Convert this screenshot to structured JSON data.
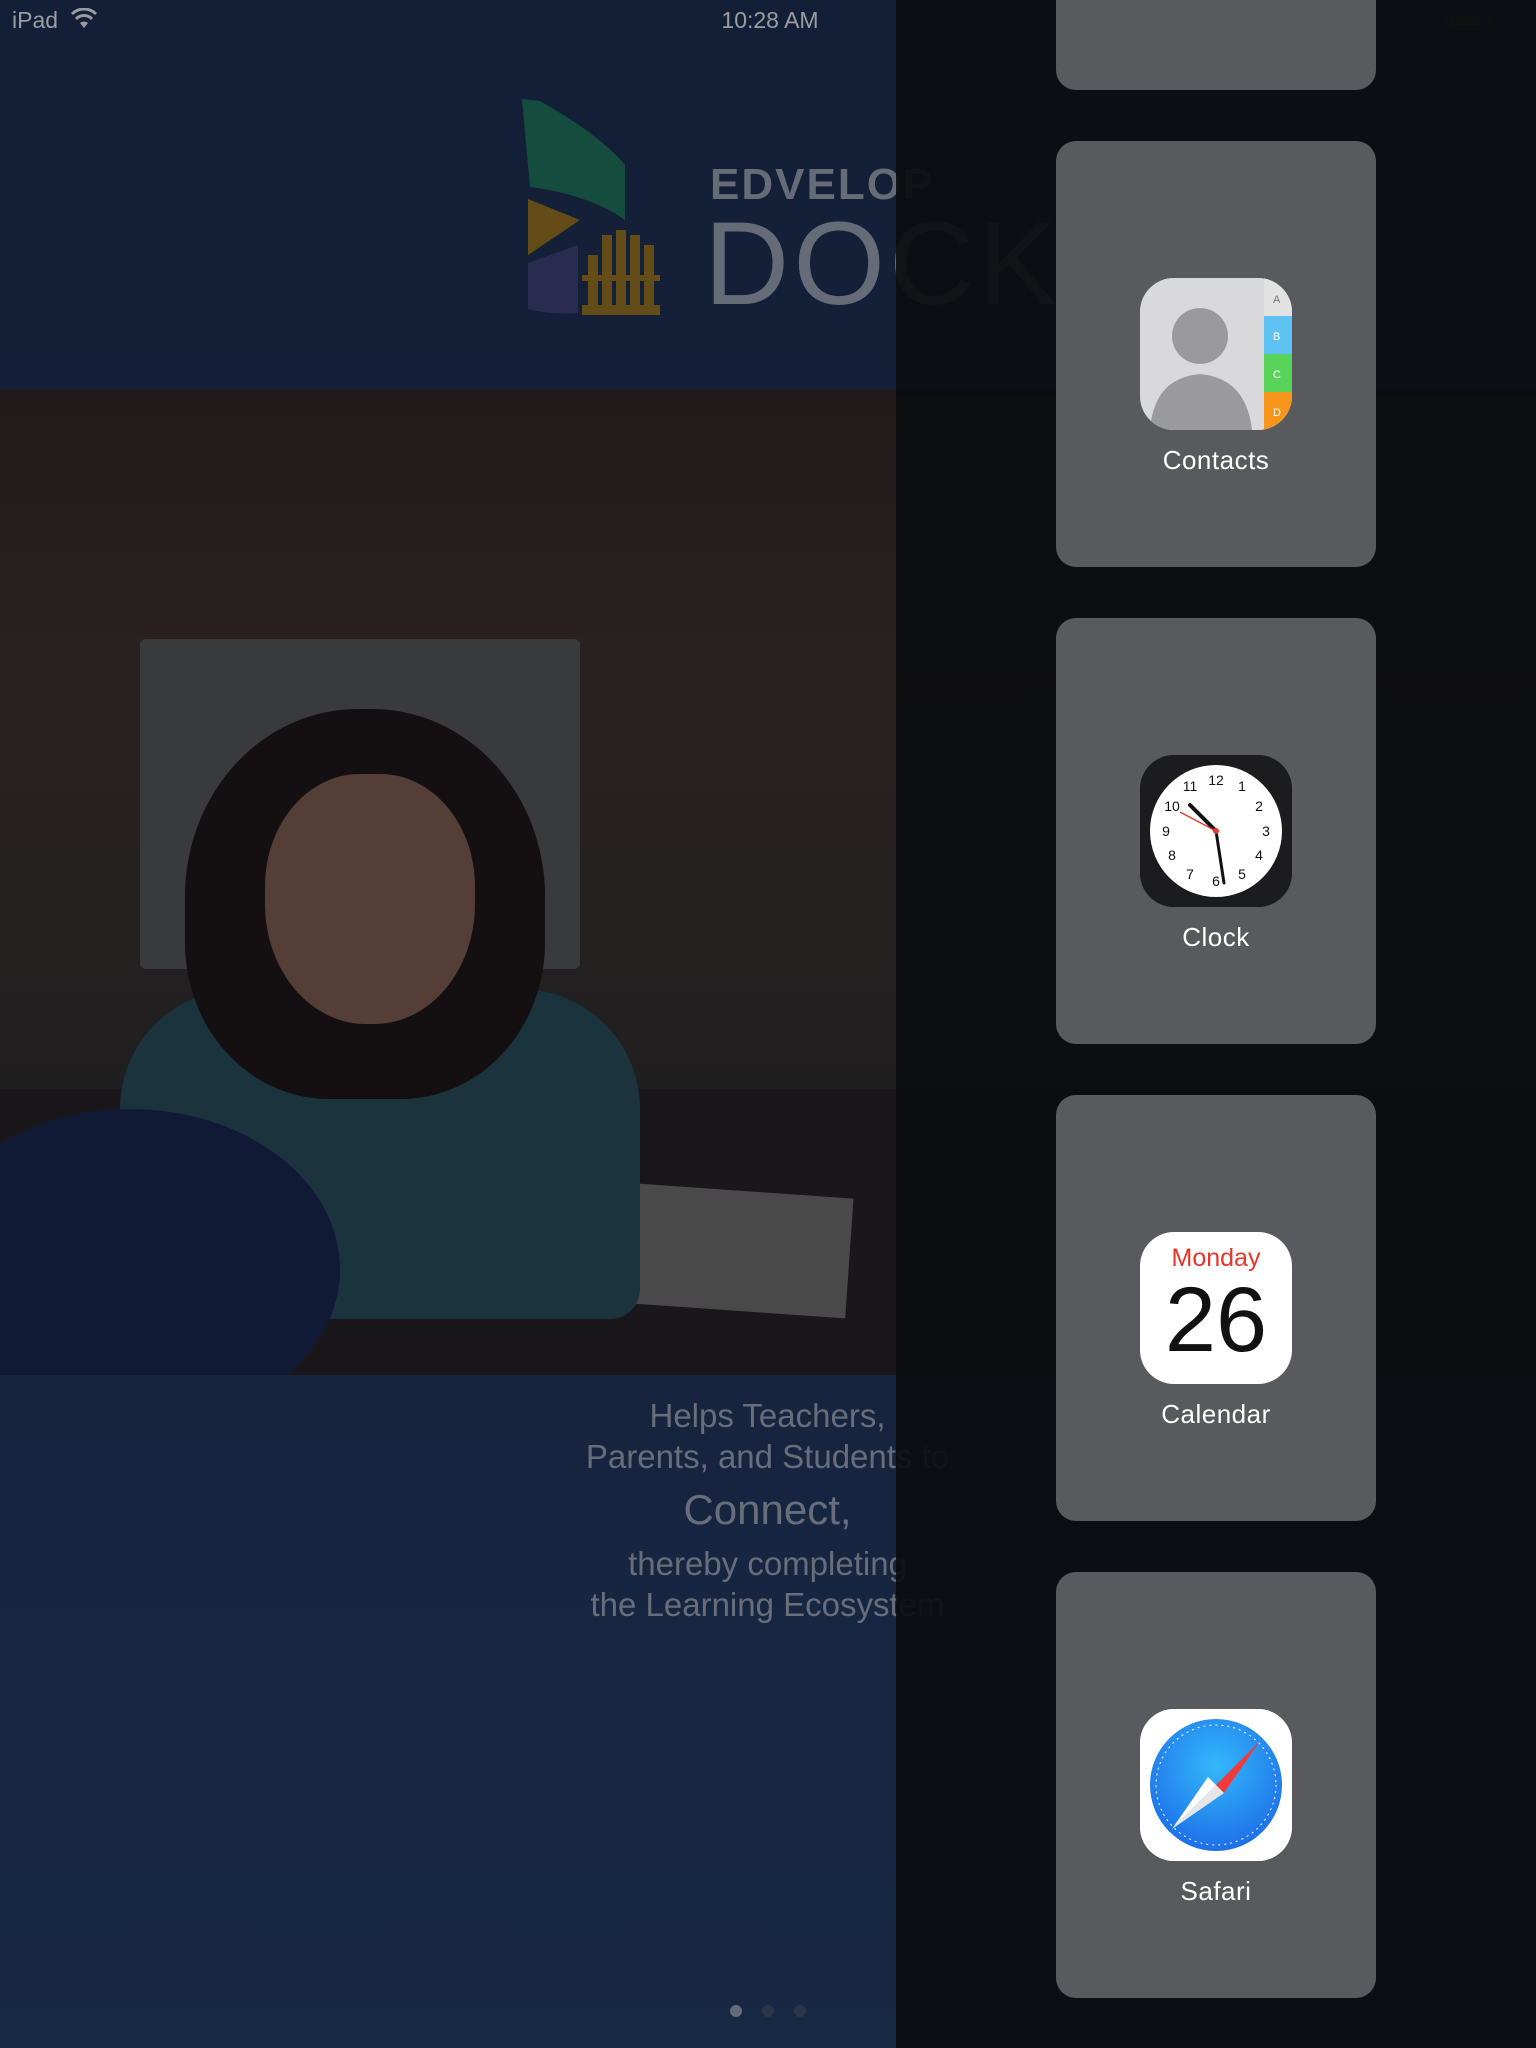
{
  "status_bar": {
    "device": "iPad",
    "time": "10:28 AM",
    "wifi_icon": "wifi-icon",
    "battery_icon": "battery-icon"
  },
  "app": {
    "logo": {
      "brand_line": "EDVELOP",
      "product_line": "DOCK"
    },
    "hero_image": "classroom-photo",
    "tagline": {
      "line1": "Helps Teachers,",
      "line2": "Parents, and Students to",
      "emphasis": "Connect,",
      "line3": "thereby completing",
      "line4": "the Learning Ecosystem"
    },
    "page_indicator": {
      "count": 3,
      "active": 0
    }
  },
  "app_picker": {
    "apps": [
      {
        "label": "Contacts",
        "icon": "contacts-icon"
      },
      {
        "label": "Clock",
        "icon": "clock-icon"
      },
      {
        "label": "Calendar",
        "icon": "calendar-icon",
        "day": "Monday",
        "date": "26"
      },
      {
        "label": "Safari",
        "icon": "safari-icon"
      }
    ]
  },
  "colors": {
    "app_background": "#1e3155",
    "panel_background": "#0c0d10",
    "card_background": "#585a5d",
    "calendar_red": "#e8352a",
    "safari_blue": "#1d8af0"
  }
}
